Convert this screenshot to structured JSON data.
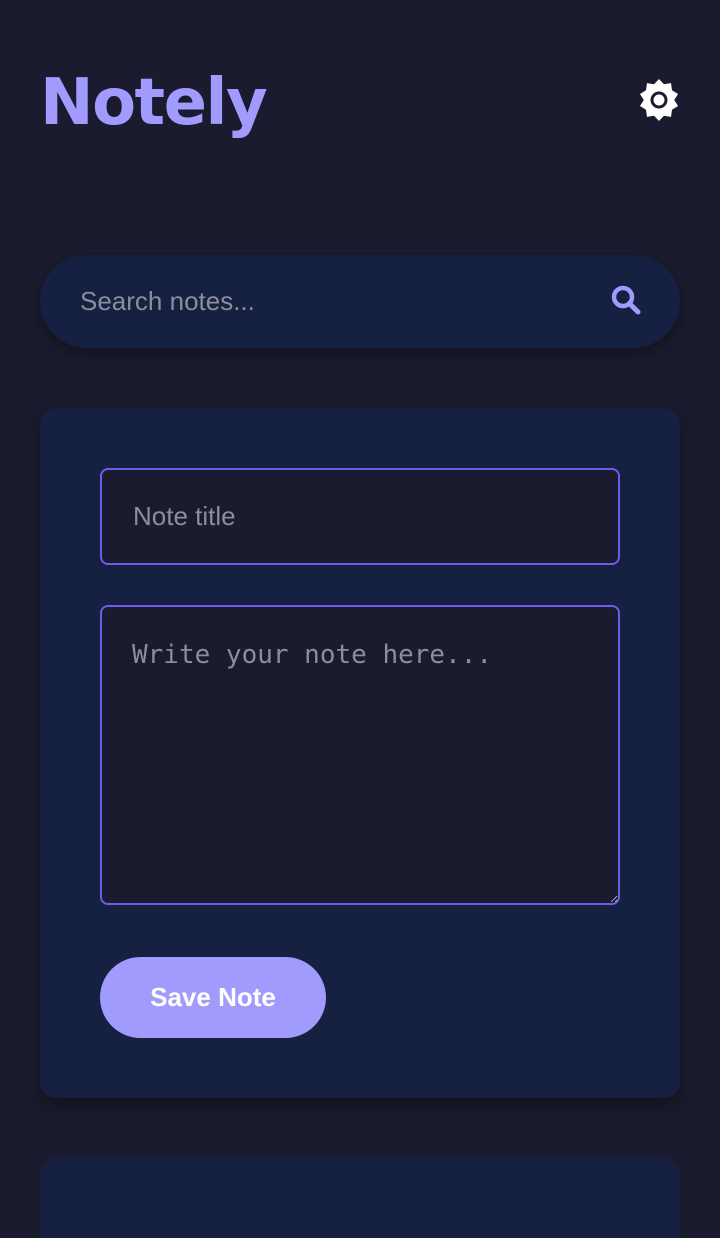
{
  "header": {
    "app_title": "Notely",
    "theme_toggle_icon": "sun-icon"
  },
  "search": {
    "placeholder": "Search notes...",
    "value": "",
    "icon": "search-icon"
  },
  "editor": {
    "title_placeholder": "Note title",
    "title_value": "",
    "body_placeholder": "Write your note here...",
    "body_value": "",
    "save_label": "Save Note"
  },
  "colors": {
    "background": "#1b1b2f",
    "card": "#162040",
    "accent": "#a29bfe",
    "input_border": "#6c5ce7",
    "placeholder": "#8a8d9c",
    "icon_light": "#ffffff"
  }
}
